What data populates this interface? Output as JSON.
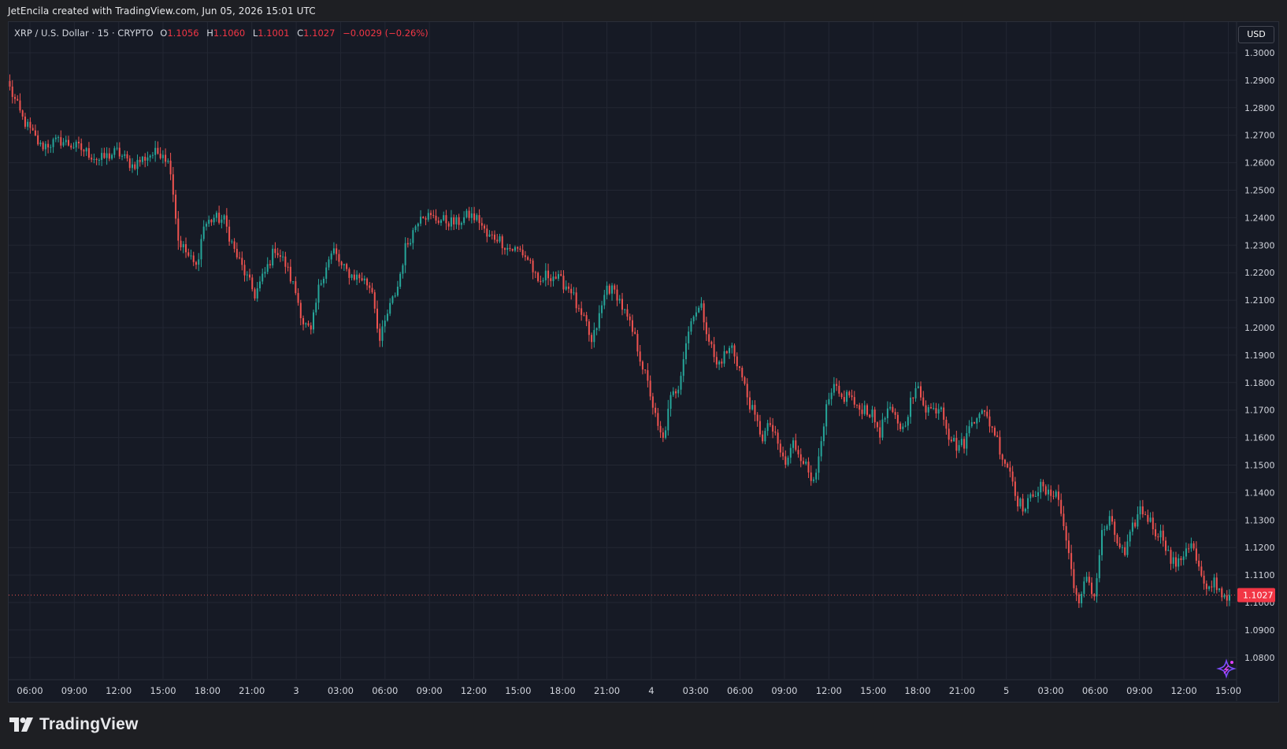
{
  "header": {
    "credit": "JetEncila created with TradingView.com, Jun 05, 2026 15:01 UTC"
  },
  "legend": {
    "symbol": "XRP / U.S. Dollar · 15 · CRYPTO",
    "open_label": "O",
    "open": "1.1056",
    "high_label": "H",
    "high": "1.1060",
    "low_label": "L",
    "low": "1.1001",
    "close_label": "C",
    "close": "1.1027",
    "change": "−0.0029 (−0.26%)"
  },
  "currency_button": "USD",
  "brand": {
    "name": "TradingView",
    "icon": "tradingview-logo-icon"
  },
  "colors": {
    "background": "#161a25",
    "up": "#26a69a",
    "down": "#ef5350",
    "grid": "#232733",
    "text": "#d1d4dc"
  },
  "chart_data": {
    "type": "candlestick",
    "series_name": "XRP / U.S. Dollar",
    "interval": "15",
    "ylim": [
      1.073,
      1.311
    ],
    "y_ticks": [
      "1.3000",
      "1.2900",
      "1.2800",
      "1.2700",
      "1.2600",
      "1.2500",
      "1.2400",
      "1.2300",
      "1.2200",
      "1.2100",
      "1.2000",
      "1.1900",
      "1.1800",
      "1.1700",
      "1.1600",
      "1.1500",
      "1.1400",
      "1.1300",
      "1.1200",
      "1.1100",
      "1.1000",
      "1.0900",
      "1.0800"
    ],
    "x_ticks": [
      "06:00",
      "09:00",
      "12:00",
      "15:00",
      "18:00",
      "21:00",
      "3",
      "03:00",
      "06:00",
      "09:00",
      "12:00",
      "15:00",
      "18:00",
      "21:00",
      "4",
      "03:00",
      "06:00",
      "09:00",
      "12:00",
      "15:00",
      "18:00",
      "21:00",
      "5",
      "03:00",
      "06:00",
      "09:00",
      "12:00",
      "15:00"
    ],
    "last_price": "1.1027",
    "price_path": [
      [
        0,
        1.287
      ],
      [
        5,
        1.276
      ],
      [
        12,
        1.266
      ],
      [
        20,
        1.268
      ],
      [
        28,
        1.265
      ],
      [
        35,
        1.261
      ],
      [
        42,
        1.264
      ],
      [
        48,
        1.259
      ],
      [
        55,
        1.263
      ],
      [
        60,
        1.264
      ],
      [
        63,
        1.258
      ],
      [
        66,
        1.232
      ],
      [
        70,
        1.226
      ],
      [
        73,
        1.222
      ],
      [
        76,
        1.237
      ],
      [
        80,
        1.24
      ],
      [
        84,
        1.239
      ],
      [
        88,
        1.228
      ],
      [
        92,
        1.22
      ],
      [
        96,
        1.212
      ],
      [
        100,
        1.22
      ],
      [
        104,
        1.229
      ],
      [
        108,
        1.223
      ],
      [
        112,
        1.213
      ],
      [
        115,
        1.202
      ],
      [
        118,
        1.198
      ],
      [
        121,
        1.214
      ],
      [
        124,
        1.223
      ],
      [
        127,
        1.228
      ],
      [
        130,
        1.222
      ],
      [
        134,
        1.219
      ],
      [
        138,
        1.218
      ],
      [
        142,
        1.214
      ],
      [
        145,
        1.195
      ],
      [
        148,
        1.205
      ],
      [
        152,
        1.215
      ],
      [
        155,
        1.229
      ],
      [
        158,
        1.235
      ],
      [
        161,
        1.242
      ],
      [
        165,
        1.24
      ],
      [
        170,
        1.239
      ],
      [
        175,
        1.238
      ],
      [
        180,
        1.241
      ],
      [
        184,
        1.239
      ],
      [
        187,
        1.233
      ],
      [
        191,
        1.233
      ],
      [
        195,
        1.229
      ],
      [
        200,
        1.228
      ],
      [
        204,
        1.224
      ],
      [
        207,
        1.215
      ],
      [
        210,
        1.219
      ],
      [
        213,
        1.219
      ],
      [
        217,
        1.216
      ],
      [
        220,
        1.214
      ],
      [
        223,
        1.205
      ],
      [
        226,
        1.201
      ],
      [
        228,
        1.194
      ],
      [
        231,
        1.204
      ],
      [
        234,
        1.215
      ],
      [
        238,
        1.212
      ],
      [
        242,
        1.203
      ],
      [
        245,
        1.196
      ],
      [
        248,
        1.186
      ],
      [
        251,
        1.176
      ],
      [
        254,
        1.163
      ],
      [
        256,
        1.159
      ],
      [
        259,
        1.174
      ],
      [
        262,
        1.179
      ],
      [
        265,
        1.195
      ],
      [
        268,
        1.206
      ],
      [
        271,
        1.207
      ],
      [
        274,
        1.196
      ],
      [
        277,
        1.186
      ],
      [
        280,
        1.19
      ],
      [
        283,
        1.193
      ],
      [
        286,
        1.185
      ],
      [
        289,
        1.175
      ],
      [
        292,
        1.167
      ],
      [
        295,
        1.16
      ],
      [
        298,
        1.165
      ],
      [
        301,
        1.157
      ],
      [
        304,
        1.15
      ],
      [
        307,
        1.158
      ],
      [
        311,
        1.152
      ],
      [
        314,
        1.145
      ],
      [
        317,
        1.151
      ],
      [
        320,
        1.17
      ],
      [
        323,
        1.178
      ],
      [
        326,
        1.174
      ],
      [
        329,
        1.176
      ],
      [
        332,
        1.17
      ],
      [
        335,
        1.171
      ],
      [
        338,
        1.168
      ],
      [
        341,
        1.162
      ],
      [
        344,
        1.17
      ],
      [
        347,
        1.167
      ],
      [
        350,
        1.163
      ],
      [
        353,
        1.173
      ],
      [
        356,
        1.178
      ],
      [
        359,
        1.171
      ],
      [
        362,
        1.17
      ],
      [
        365,
        1.172
      ],
      [
        368,
        1.161
      ],
      [
        371,
        1.157
      ],
      [
        374,
        1.158
      ],
      [
        377,
        1.166
      ],
      [
        380,
        1.17
      ],
      [
        383,
        1.167
      ],
      [
        386,
        1.162
      ],
      [
        389,
        1.153
      ],
      [
        392,
        1.148
      ],
      [
        395,
        1.137
      ],
      [
        398,
        1.134
      ],
      [
        401,
        1.14
      ],
      [
        404,
        1.142
      ],
      [
        407,
        1.139
      ],
      [
        410,
        1.141
      ],
      [
        413,
        1.128
      ],
      [
        416,
        1.112
      ],
      [
        419,
        1.098
      ],
      [
        422,
        1.11
      ],
      [
        425,
        1.102
      ],
      [
        428,
        1.125
      ],
      [
        431,
        1.13
      ],
      [
        434,
        1.122
      ],
      [
        437,
        1.117
      ],
      [
        440,
        1.127
      ],
      [
        443,
        1.134
      ],
      [
        446,
        1.131
      ],
      [
        449,
        1.126
      ],
      [
        452,
        1.124
      ],
      [
        455,
        1.115
      ],
      [
        458,
        1.114
      ],
      [
        461,
        1.12
      ],
      [
        463,
        1.122
      ],
      [
        466,
        1.112
      ],
      [
        469,
        1.103
      ],
      [
        472,
        1.108
      ],
      [
        475,
        1.103
      ],
      [
        478,
        1.1027
      ]
    ]
  }
}
